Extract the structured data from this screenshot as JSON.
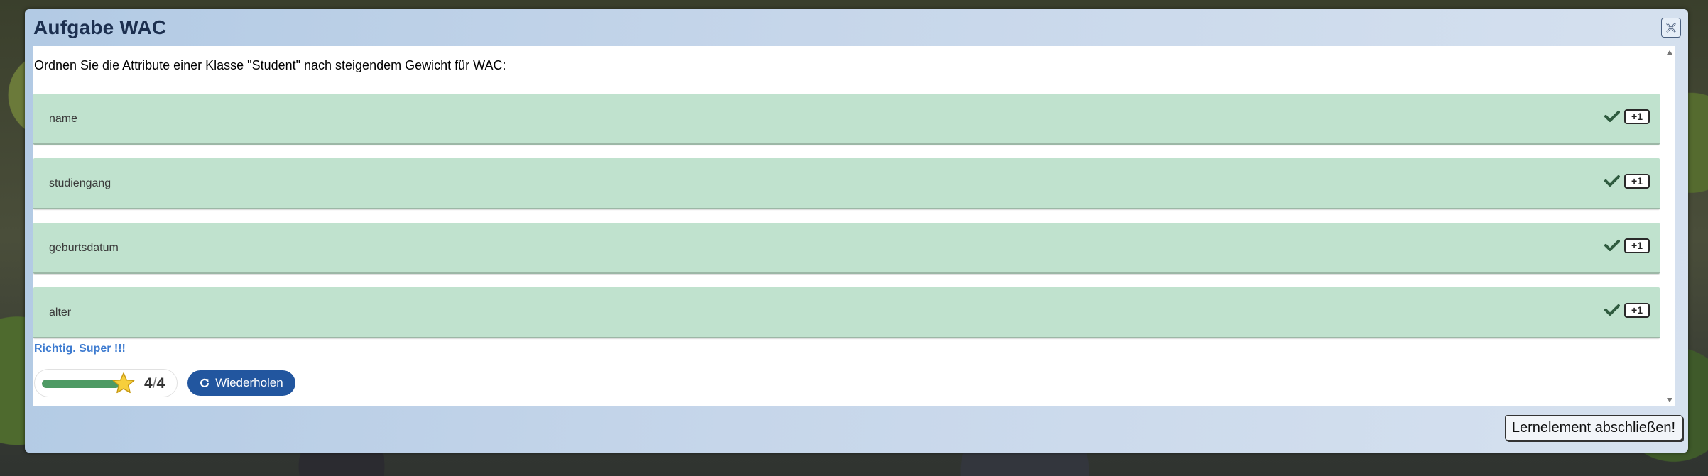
{
  "dialog": {
    "title": "Aufgabe WAC",
    "prompt": "Ordnen Sie die Attribute einer Klasse \"Student\" nach steigendem Gewicht für WAC:",
    "items": [
      {
        "label": "name",
        "badge": "+1"
      },
      {
        "label": "studiengang",
        "badge": "+1"
      },
      {
        "label": "geburtsdatum",
        "badge": "+1"
      },
      {
        "label": "alter",
        "badge": "+1"
      }
    ],
    "feedback": "Richtig. Super !!!",
    "score": {
      "current": "4",
      "separator": "/",
      "total": "4",
      "progress_fraction": 1.0
    },
    "repeat_label": "Wiederholen",
    "finish_label": "Lernelement abschließen!"
  },
  "colors": {
    "item_background": "#c0e2ce",
    "accent_blue": "#22569f",
    "feedback_text": "#3d7bd0",
    "progress_fill": "#4e9a64"
  },
  "icons": [
    "close-icon",
    "check-icon",
    "star-icon",
    "refresh-icon"
  ]
}
